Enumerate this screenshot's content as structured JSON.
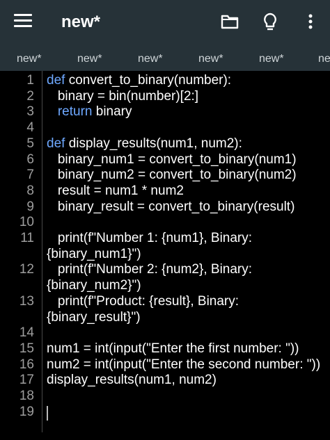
{
  "app": {
    "title": "new*"
  },
  "icons": {
    "menu": "hamburger-menu-icon",
    "open": "folder-icon",
    "hint": "lightbulb-icon",
    "more": "more-vert-icon"
  },
  "tabs": [
    "new*",
    "new*",
    "new*",
    "new*",
    "new*",
    "ne"
  ],
  "code": {
    "lines": [
      {
        "n": "1",
        "kw": "def",
        "text": " convert_to_binary(number):"
      },
      {
        "n": "2",
        "kw": "",
        "text": "   binary = bin(number)[2:]"
      },
      {
        "n": "3",
        "kw": "   return",
        "text": " binary"
      },
      {
        "n": "4",
        "kw": "",
        "text": ""
      },
      {
        "n": "5",
        "kw": "def",
        "text": " display_results(num1, num2):"
      },
      {
        "n": "6",
        "kw": "",
        "text": "   binary_num1 = convert_to_binary(num1)"
      },
      {
        "n": "7",
        "kw": "",
        "text": "   binary_num2 = convert_to_binary(num2)"
      },
      {
        "n": "8",
        "kw": "",
        "text": "   result = num1 * num2"
      },
      {
        "n": "9",
        "kw": "",
        "text": "   binary_result = convert_to_binary(result)"
      },
      {
        "n": "10",
        "kw": "",
        "text": ""
      },
      {
        "n": "11",
        "kw": "",
        "text": "   print(f\"Number 1: {num1}, Binary:"
      },
      {
        "n": "",
        "kw": "",
        "text": "{binary_num1}\")"
      },
      {
        "n": "12",
        "kw": "",
        "text": "   print(f\"Number 2: {num2}, Binary:"
      },
      {
        "n": "",
        "kw": "",
        "text": "{binary_num2}\")"
      },
      {
        "n": "13",
        "kw": "",
        "text": "   print(f\"Product: {result}, Binary:"
      },
      {
        "n": "",
        "kw": "",
        "text": "{binary_result}\")"
      },
      {
        "n": "14",
        "kw": "",
        "text": ""
      },
      {
        "n": "15",
        "kw": "",
        "text": "num1 = int(input(\"Enter the first number: \"))"
      },
      {
        "n": "16",
        "kw": "",
        "text": "num2 = int(input(\"Enter the second number: \"))"
      },
      {
        "n": "17",
        "kw": "",
        "text": "display_results(num1, num2)"
      },
      {
        "n": "18",
        "kw": "",
        "text": ""
      },
      {
        "n": "19",
        "kw": "",
        "text": ""
      }
    ]
  },
  "colors": {
    "appbar": "#263238",
    "keyword": "#6ea8ff",
    "line_number": "#9e9e9e",
    "background": "#000000"
  }
}
